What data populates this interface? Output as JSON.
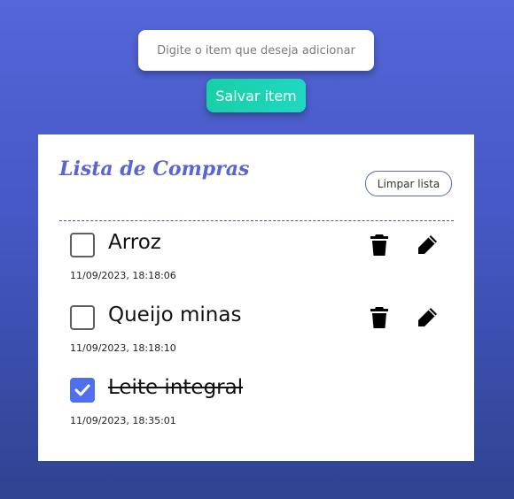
{
  "form": {
    "input_placeholder": "Digite o item que deseja adicionar",
    "save_label": "Salvar item"
  },
  "list": {
    "title": "Lista de Compras",
    "clear_label": "Limpar lista",
    "items": [
      {
        "name": "Arroz",
        "timestamp": "11/09/2023, 18:18:06",
        "checked": false
      },
      {
        "name": "Queijo minas",
        "timestamp": "11/09/2023, 18:18:10",
        "checked": false
      },
      {
        "name": "Leite integral",
        "timestamp": "11/09/2023, 18:35:01",
        "checked": true
      }
    ]
  },
  "icons": {
    "delete": "trash-icon",
    "edit": "pencil-icon",
    "check": "check-icon"
  },
  "colors": {
    "background_top": "#5566d8",
    "background_bottom": "#2f4392",
    "save_button": "#1fd8c0",
    "title": "#5a64d2",
    "checkbox_checked": "#4d6ff0",
    "divider": "#6a3fc4"
  }
}
